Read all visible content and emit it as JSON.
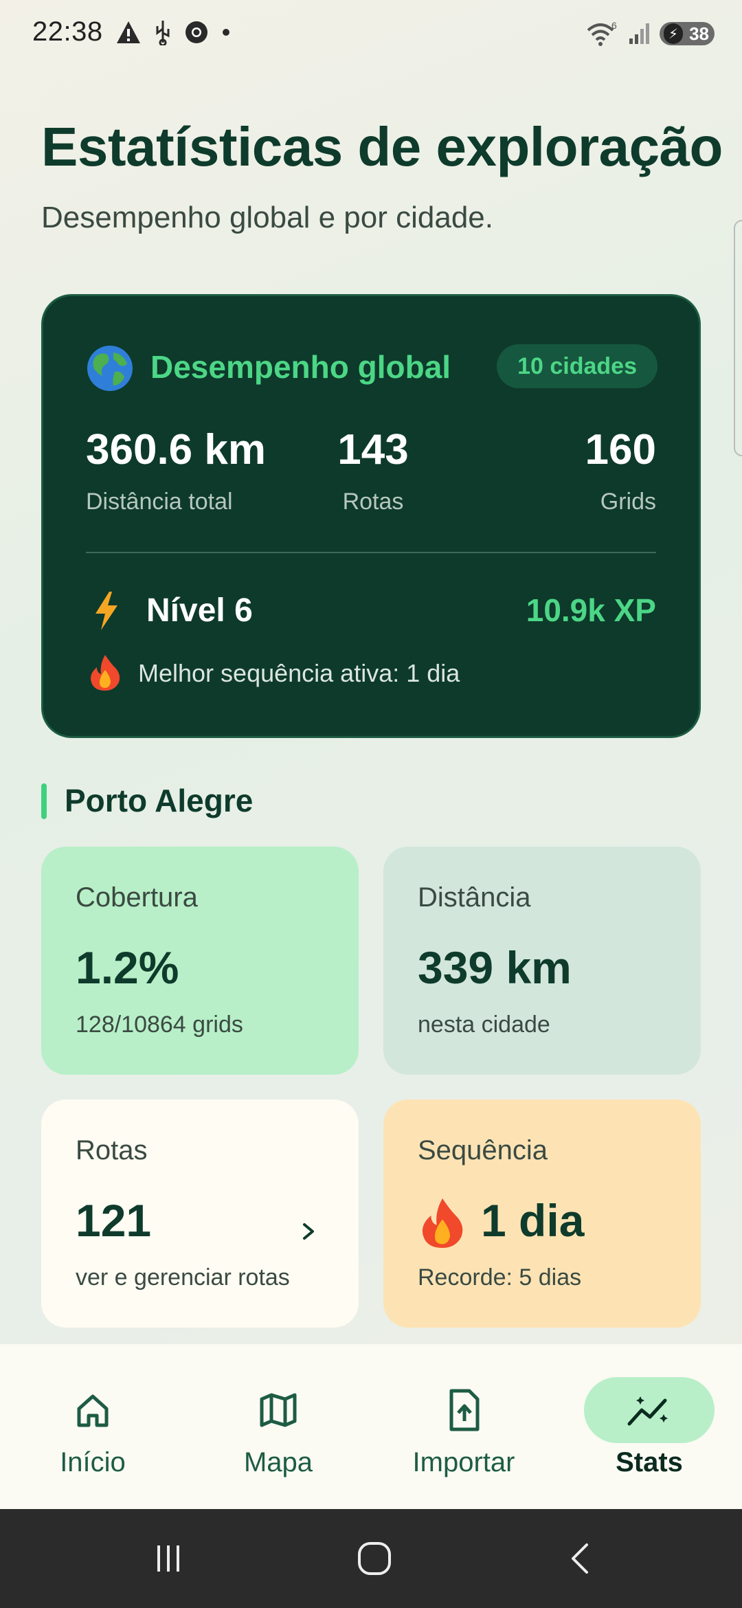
{
  "status_bar": {
    "time": "22:38",
    "battery": "38",
    "wifi_badge": "6"
  },
  "page": {
    "title": "Estatísticas de exploração",
    "subtitle": "Desempenho global e por cidade."
  },
  "global": {
    "title": "Desempenho global",
    "badge": "10 cidades",
    "stats": [
      {
        "value": "360.6 km",
        "label": "Distância total"
      },
      {
        "value": "143",
        "label": "Rotas"
      },
      {
        "value": "160",
        "label": "Grids"
      }
    ],
    "level": "Nível 6",
    "xp": "10.9k XP",
    "streak": "Melhor sequência ativa: 1 dia"
  },
  "city": {
    "name": "Porto Alegre",
    "tiles": {
      "coverage": {
        "label": "Cobertura",
        "value": "1.2%",
        "sub": "128/10864 grids"
      },
      "distance": {
        "label": "Distância",
        "value": "339 km",
        "sub": "nesta cidade"
      },
      "routes": {
        "label": "Rotas",
        "value": "121",
        "sub": "ver e gerenciar rotas"
      },
      "streak": {
        "label": "Sequência",
        "value": "1 dia",
        "sub": "Recorde: 5 dias"
      }
    }
  },
  "nav": {
    "items": [
      {
        "label": "Início",
        "icon": "home-icon"
      },
      {
        "label": "Mapa",
        "icon": "map-icon"
      },
      {
        "label": "Importar",
        "icon": "file-upload-icon"
      },
      {
        "label": "Stats",
        "icon": "stats-icon"
      }
    ],
    "active": "Stats"
  },
  "colors": {
    "accent": "#4cd686",
    "card_dark": "#0d3a2b",
    "text_dark": "#0e3b2c"
  }
}
